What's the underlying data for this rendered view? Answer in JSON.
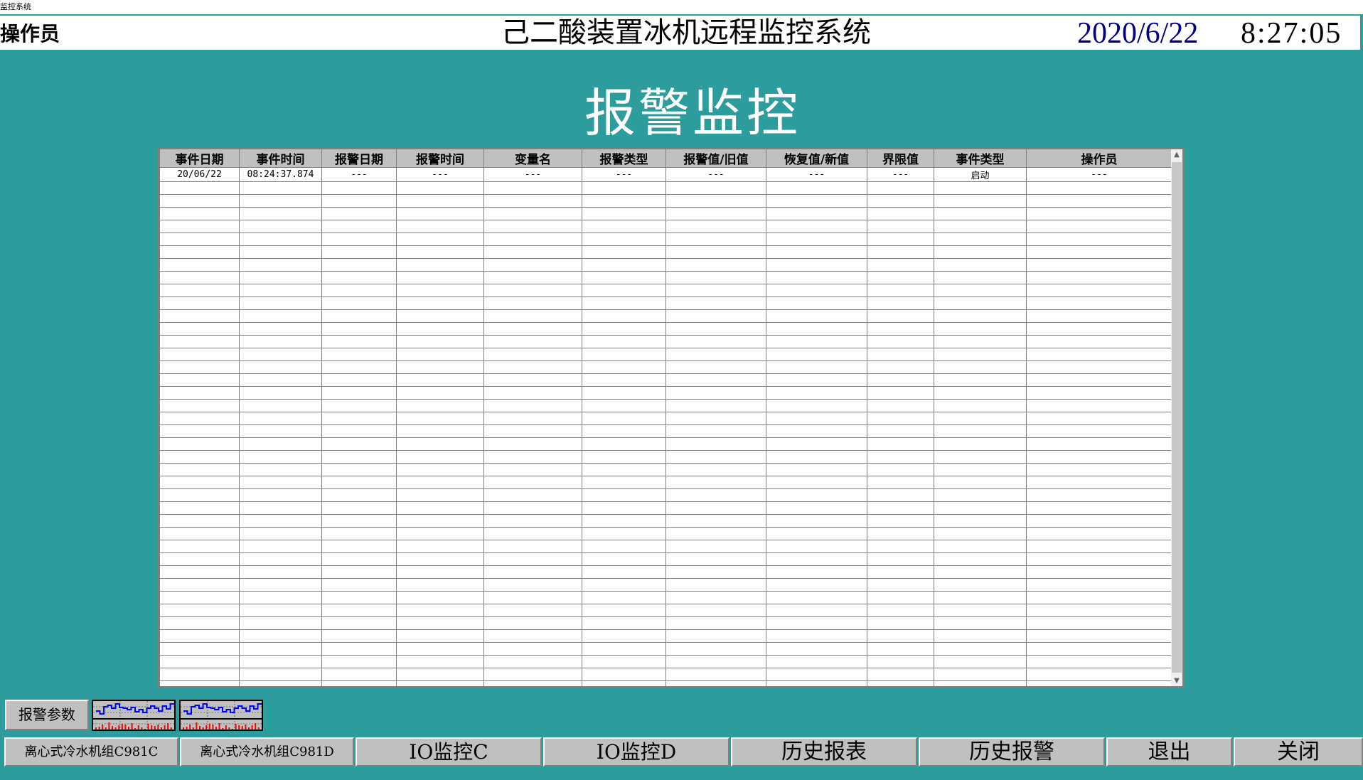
{
  "window": {
    "title": "监控系统"
  },
  "header": {
    "operator_label": "操作员",
    "system_title": "己二酸装置冰机远程监控系统",
    "date": "2020/6/22",
    "time": "8:27:05"
  },
  "page_title": "报警监控",
  "alarm_table": {
    "columns": [
      "事件日期",
      "事件时间",
      "报警日期",
      "报警时间",
      "变量名",
      "报警类型",
      "报警值/旧值",
      "恢复值/新值",
      "界限值",
      "事件类型",
      "操作员"
    ],
    "rows": [
      [
        "20/06/22",
        "08:24:37.874",
        "---",
        "---",
        "---",
        "---",
        "---",
        "---",
        "---",
        "启动",
        "---"
      ]
    ]
  },
  "buttons": {
    "alarm_params": "报警参数",
    "chiller_c": "离心式冷水机组C981C",
    "chiller_d": "离心式冷水机组C981D",
    "io_c": "IO监控C",
    "io_d": "IO监控D",
    "history_report": "历史报表",
    "history_alarm": "历史报警",
    "exit": "退出",
    "close": "关闭"
  },
  "colors": {
    "background": "#2c9c9c",
    "date_color": "#000080",
    "trend_line": "#0000ff",
    "trend_bars": "#ff0000"
  }
}
